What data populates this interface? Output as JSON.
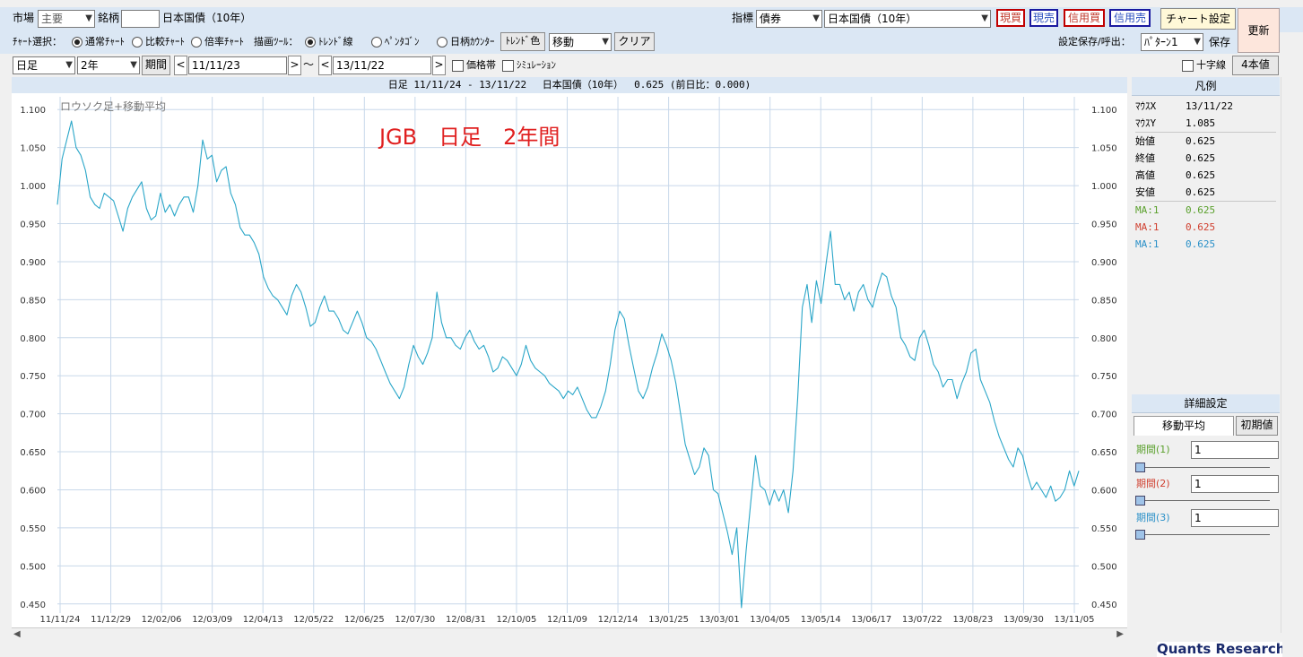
{
  "toolbar1": {
    "market_label": "市場",
    "market_value": "主要",
    "symbol_label": "銘柄",
    "symbol_value": "",
    "symbol_name": "日本国債（10年）",
    "indicator_label": "指標",
    "indicator_type": "債券",
    "indicator_value": "日本国債（10年）",
    "btn_genbai": "現買",
    "btn_genbai2": "現売",
    "btn_shinyobai": "信用買",
    "btn_shinyobai2": "信用売",
    "btn_chart_settings": "チャート設定",
    "btn_update": "更新"
  },
  "toolbar2": {
    "chart_select_label": "ﾁｬｰﾄ選択：",
    "radio_normal": "通常ﾁｬｰﾄ",
    "radio_compare": "比較ﾁｬｰﾄ",
    "radio_ratio": "倍率ﾁｬｰﾄ",
    "draw_tool_label": "描画ﾂｰﾙ：",
    "radio_trend": "ﾄﾚﾝﾄﾞ線",
    "radio_pentagon": "ﾍﾟﾝﾀｺﾞﾝ",
    "radio_counter": "日柄ｶｳﾝﾀｰ",
    "btn_trend_color": "ﾄﾚﾝﾄﾞ色",
    "move_select": "移動",
    "btn_clear": "クリア",
    "save_label": "設定保存/呼出：",
    "pattern_select": "ﾊﾟﾀｰﾝ1",
    "btn_save": "保存"
  },
  "toolbar3": {
    "period_type": "日足",
    "period_len": "2年",
    "btn_period": "期間",
    "start_date": "11/11/23",
    "tilde": "～",
    "end_date": "13/11/22",
    "check_price_band": "価格帯",
    "check_simulation": "ｼﾐｭﾚｰｼｮﾝ",
    "check_crosshair": "十字線",
    "btn_four_values": "4本値"
  },
  "chart_header": "日足 11/11/24 - 13/11/22　 日本国債（10年）　 0.625 (前日比：0.000)",
  "chart_data": {
    "type": "line",
    "subtitle": "ロウソク足+移動平均",
    "title": "JGB　日足　2年間",
    "title_color": "#e02020",
    "line_color": "#2aa6c8",
    "ylim": [
      0.445,
      1.105
    ],
    "yticks": [
      "1.100",
      "1.050",
      "1.000",
      "0.950",
      "0.900",
      "0.850",
      "0.800",
      "0.750",
      "0.700",
      "0.650",
      "0.600",
      "0.550",
      "0.500",
      "0.450"
    ],
    "xticks": [
      "11/11/24",
      "11/12/29",
      "12/02/06",
      "12/03/09",
      "12/04/13",
      "12/05/22",
      "12/06/25",
      "12/07/30",
      "12/08/31",
      "12/10/05",
      "12/11/09",
      "12/12/14",
      "13/01/25",
      "13/03/01",
      "13/04/05",
      "13/05/14",
      "13/06/17",
      "13/07/22",
      "13/08/23",
      "13/09/30",
      "13/11/05"
    ],
    "series": [
      {
        "values": [
          [
            0,
            0.975
          ],
          [
            1,
            1.035
          ],
          [
            2,
            1.06
          ],
          [
            3,
            1.085
          ],
          [
            4,
            1.05
          ],
          [
            5,
            1.04
          ],
          [
            6,
            1.02
          ],
          [
            7,
            0.985
          ],
          [
            8,
            0.975
          ],
          [
            9,
            0.97
          ],
          [
            10,
            0.99
          ],
          [
            11,
            0.985
          ],
          [
            12,
            0.98
          ],
          [
            13,
            0.96
          ],
          [
            14,
            0.94
          ],
          [
            15,
            0.97
          ],
          [
            16,
            0.985
          ],
          [
            17,
            0.995
          ],
          [
            18,
            1.005
          ],
          [
            19,
            0.97
          ],
          [
            20,
            0.955
          ],
          [
            21,
            0.96
          ],
          [
            22,
            0.99
          ],
          [
            23,
            0.965
          ],
          [
            24,
            0.975
          ],
          [
            25,
            0.96
          ],
          [
            26,
            0.975
          ],
          [
            27,
            0.985
          ],
          [
            28,
            0.985
          ],
          [
            29,
            0.965
          ],
          [
            30,
            1.0
          ],
          [
            31,
            1.06
          ],
          [
            32,
            1.035
          ],
          [
            33,
            1.04
          ],
          [
            34,
            1.005
          ],
          [
            35,
            1.02
          ],
          [
            36,
            1.025
          ],
          [
            37,
            0.99
          ],
          [
            38,
            0.975
          ],
          [
            39,
            0.945
          ],
          [
            40,
            0.935
          ],
          [
            41,
            0.935
          ],
          [
            42,
            0.925
          ],
          [
            43,
            0.91
          ],
          [
            44,
            0.88
          ],
          [
            45,
            0.865
          ],
          [
            46,
            0.855
          ],
          [
            47,
            0.85
          ],
          [
            48,
            0.84
          ],
          [
            49,
            0.83
          ],
          [
            50,
            0.855
          ],
          [
            51,
            0.87
          ],
          [
            52,
            0.86
          ],
          [
            53,
            0.84
          ],
          [
            54,
            0.815
          ],
          [
            55,
            0.82
          ],
          [
            56,
            0.84
          ],
          [
            57,
            0.855
          ],
          [
            58,
            0.835
          ],
          [
            59,
            0.835
          ],
          [
            60,
            0.825
          ],
          [
            61,
            0.81
          ],
          [
            62,
            0.805
          ],
          [
            63,
            0.82
          ],
          [
            64,
            0.835
          ],
          [
            65,
            0.82
          ],
          [
            66,
            0.8
          ],
          [
            67,
            0.795
          ],
          [
            68,
            0.785
          ],
          [
            69,
            0.77
          ],
          [
            70,
            0.755
          ],
          [
            71,
            0.74
          ],
          [
            72,
            0.73
          ],
          [
            73,
            0.72
          ],
          [
            74,
            0.735
          ],
          [
            75,
            0.765
          ],
          [
            76,
            0.79
          ],
          [
            77,
            0.775
          ],
          [
            78,
            0.765
          ],
          [
            79,
            0.78
          ],
          [
            80,
            0.8
          ],
          [
            81,
            0.86
          ],
          [
            82,
            0.82
          ],
          [
            83,
            0.8
          ],
          [
            84,
            0.8
          ],
          [
            85,
            0.79
          ],
          [
            86,
            0.785
          ],
          [
            87,
            0.8
          ],
          [
            88,
            0.81
          ],
          [
            89,
            0.795
          ],
          [
            90,
            0.785
          ],
          [
            91,
            0.79
          ],
          [
            92,
            0.775
          ],
          [
            93,
            0.755
          ],
          [
            94,
            0.76
          ],
          [
            95,
            0.775
          ],
          [
            96,
            0.77
          ],
          [
            97,
            0.76
          ],
          [
            98,
            0.75
          ],
          [
            99,
            0.765
          ],
          [
            100,
            0.79
          ],
          [
            101,
            0.77
          ],
          [
            102,
            0.76
          ],
          [
            103,
            0.755
          ],
          [
            104,
            0.75
          ],
          [
            105,
            0.74
          ],
          [
            106,
            0.735
          ],
          [
            107,
            0.73
          ],
          [
            108,
            0.72
          ],
          [
            109,
            0.73
          ],
          [
            110,
            0.725
          ],
          [
            111,
            0.735
          ],
          [
            112,
            0.72
          ],
          [
            113,
            0.705
          ],
          [
            114,
            0.695
          ],
          [
            115,
            0.695
          ],
          [
            116,
            0.71
          ],
          [
            117,
            0.73
          ],
          [
            118,
            0.765
          ],
          [
            119,
            0.81
          ],
          [
            120,
            0.835
          ],
          [
            121,
            0.825
          ],
          [
            122,
            0.79
          ],
          [
            123,
            0.76
          ],
          [
            124,
            0.73
          ],
          [
            125,
            0.72
          ],
          [
            126,
            0.735
          ],
          [
            127,
            0.76
          ],
          [
            128,
            0.78
          ],
          [
            129,
            0.805
          ],
          [
            130,
            0.79
          ],
          [
            131,
            0.77
          ],
          [
            132,
            0.74
          ],
          [
            133,
            0.7
          ],
          [
            134,
            0.66
          ],
          [
            135,
            0.64
          ],
          [
            136,
            0.62
          ],
          [
            137,
            0.63
          ],
          [
            138,
            0.655
          ],
          [
            139,
            0.645
          ],
          [
            140,
            0.6
          ],
          [
            141,
            0.595
          ],
          [
            142,
            0.57
          ],
          [
            143,
            0.545
          ],
          [
            144,
            0.515
          ],
          [
            145,
            0.55
          ],
          [
            146,
            0.445
          ],
          [
            147,
            0.52
          ],
          [
            148,
            0.585
          ],
          [
            149,
            0.645
          ],
          [
            150,
            0.605
          ],
          [
            151,
            0.6
          ],
          [
            152,
            0.58
          ],
          [
            153,
            0.6
          ],
          [
            154,
            0.585
          ],
          [
            155,
            0.6
          ],
          [
            156,
            0.57
          ],
          [
            157,
            0.625
          ],
          [
            158,
            0.72
          ],
          [
            159,
            0.84
          ],
          [
            160,
            0.87
          ],
          [
            161,
            0.82
          ],
          [
            162,
            0.875
          ],
          [
            163,
            0.845
          ],
          [
            164,
            0.895
          ],
          [
            165,
            0.94
          ],
          [
            166,
            0.87
          ],
          [
            167,
            0.87
          ],
          [
            168,
            0.85
          ],
          [
            169,
            0.86
          ],
          [
            170,
            0.835
          ],
          [
            171,
            0.86
          ],
          [
            172,
            0.87
          ],
          [
            173,
            0.85
          ],
          [
            174,
            0.84
          ],
          [
            175,
            0.865
          ],
          [
            176,
            0.885
          ],
          [
            177,
            0.88
          ],
          [
            178,
            0.855
          ],
          [
            179,
            0.84
          ],
          [
            180,
            0.8
          ],
          [
            181,
            0.79
          ],
          [
            182,
            0.775
          ],
          [
            183,
            0.77
          ],
          [
            184,
            0.8
          ],
          [
            185,
            0.81
          ],
          [
            186,
            0.79
          ],
          [
            187,
            0.765
          ],
          [
            188,
            0.755
          ],
          [
            189,
            0.735
          ],
          [
            190,
            0.745
          ],
          [
            191,
            0.745
          ],
          [
            192,
            0.72
          ],
          [
            193,
            0.74
          ],
          [
            194,
            0.755
          ],
          [
            195,
            0.78
          ],
          [
            196,
            0.785
          ],
          [
            197,
            0.745
          ],
          [
            198,
            0.73
          ],
          [
            199,
            0.715
          ],
          [
            200,
            0.69
          ],
          [
            201,
            0.67
          ],
          [
            202,
            0.655
          ],
          [
            203,
            0.64
          ],
          [
            204,
            0.63
          ],
          [
            205,
            0.655
          ],
          [
            206,
            0.645
          ],
          [
            207,
            0.62
          ],
          [
            208,
            0.6
          ],
          [
            209,
            0.61
          ],
          [
            210,
            0.6
          ],
          [
            211,
            0.59
          ],
          [
            212,
            0.605
          ],
          [
            213,
            0.585
          ],
          [
            214,
            0.59
          ],
          [
            215,
            0.6
          ],
          [
            216,
            0.625
          ],
          [
            217,
            0.605
          ],
          [
            218,
            0.625
          ]
        ]
      }
    ]
  },
  "legend": {
    "header": "凡例",
    "mouse_x_label": "ﾏｳｽX",
    "mouse_x": "13/11/22",
    "mouse_y_label": "ﾏｳｽY",
    "mouse_y": "1.085",
    "open_label": "始値",
    "open": "0.625",
    "close_label": "終値",
    "close": "0.625",
    "high_label": "高値",
    "high": "0.625",
    "low_label": "安値",
    "low": "0.625",
    "ma1_label": "MA:1",
    "ma1": "0.625",
    "ma1_color": "#5aa02c",
    "ma2_label": "MA:1",
    "ma2": "0.625",
    "ma2_color": "#d04030",
    "ma3_label": "MA:1",
    "ma3": "0.625",
    "ma3_color": "#2a90c8"
  },
  "details": {
    "header": "詳細設定",
    "tab_ma": "移動平均",
    "btn_init": "初期値",
    "period1_label": "期間(1)",
    "period1": "1",
    "period2_label": "期間(2)",
    "period2": "1",
    "period3_label": "期間(3)",
    "period3": "1"
  },
  "footer_logo": "Quants Research"
}
